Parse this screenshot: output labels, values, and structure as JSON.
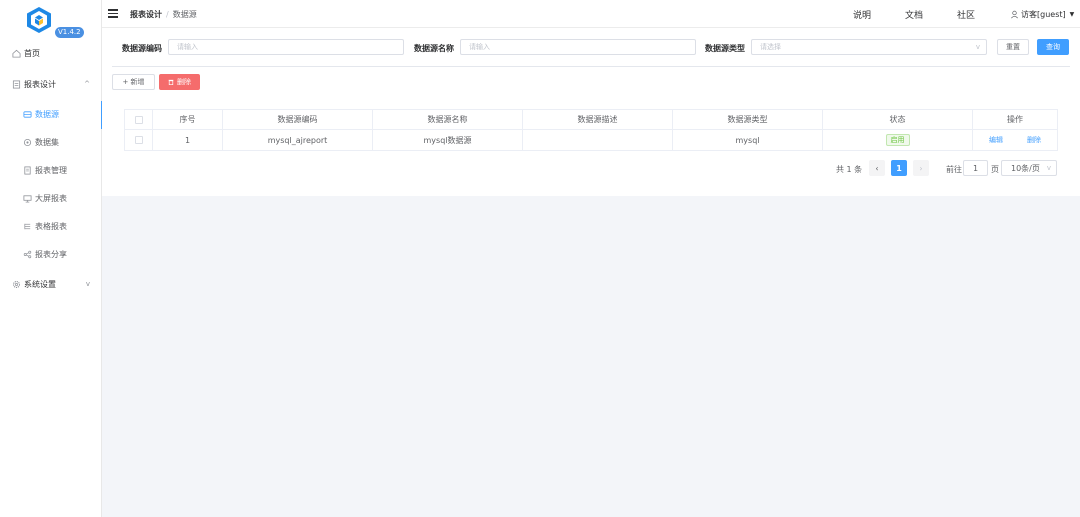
{
  "app": {
    "version": "V1.4.2"
  },
  "sidebar": {
    "items": [
      {
        "label": "首页",
        "icon": "home-icon"
      },
      {
        "label": "报表设计",
        "icon": "report-design-icon"
      },
      {
        "label": "数据源",
        "icon": "datasource-icon"
      },
      {
        "label": "数据集",
        "icon": "dataset-icon"
      },
      {
        "label": "报表管理",
        "icon": "report-manage-icon"
      },
      {
        "label": "大屏报表",
        "icon": "screen-icon"
      },
      {
        "label": "表格报表",
        "icon": "table-icon"
      },
      {
        "label": "报表分享",
        "icon": "share-icon"
      },
      {
        "label": "系统设置",
        "icon": "gear-icon"
      }
    ]
  },
  "header": {
    "breadcrumb": [
      "报表设计",
      "数据源"
    ],
    "links": [
      "说明",
      "文档",
      "社区"
    ],
    "user": "访客[guest]"
  },
  "filters": {
    "code_label": "数据源编码",
    "code_placeholder": "请输入",
    "name_label": "数据源名称",
    "name_placeholder": "请输入",
    "type_label": "数据源类型",
    "type_placeholder": "请选择",
    "reset_label": "重置",
    "query_label": "查询"
  },
  "toolbar": {
    "add_label": "+ 新增",
    "delete_label": "删除"
  },
  "table": {
    "columns": [
      "序号",
      "数据源编码",
      "数据源名称",
      "数据源描述",
      "数据源类型",
      "状态",
      "操作"
    ],
    "rows": [
      {
        "index": "1",
        "code": "mysql_ajreport",
        "name": "mysql数据源",
        "desc": "",
        "type": "mysql",
        "status": "启用",
        "edit": "编辑",
        "delete": "删除"
      }
    ]
  },
  "pagination": {
    "total": "共 1 条",
    "current_page": "1",
    "goto_prefix": "前往",
    "goto_value": "1",
    "goto_suffix": "页",
    "page_size": "10条/页"
  },
  "colors": {
    "primary": "#409eff",
    "danger": "#f56c6c",
    "success": "#67c23a"
  }
}
